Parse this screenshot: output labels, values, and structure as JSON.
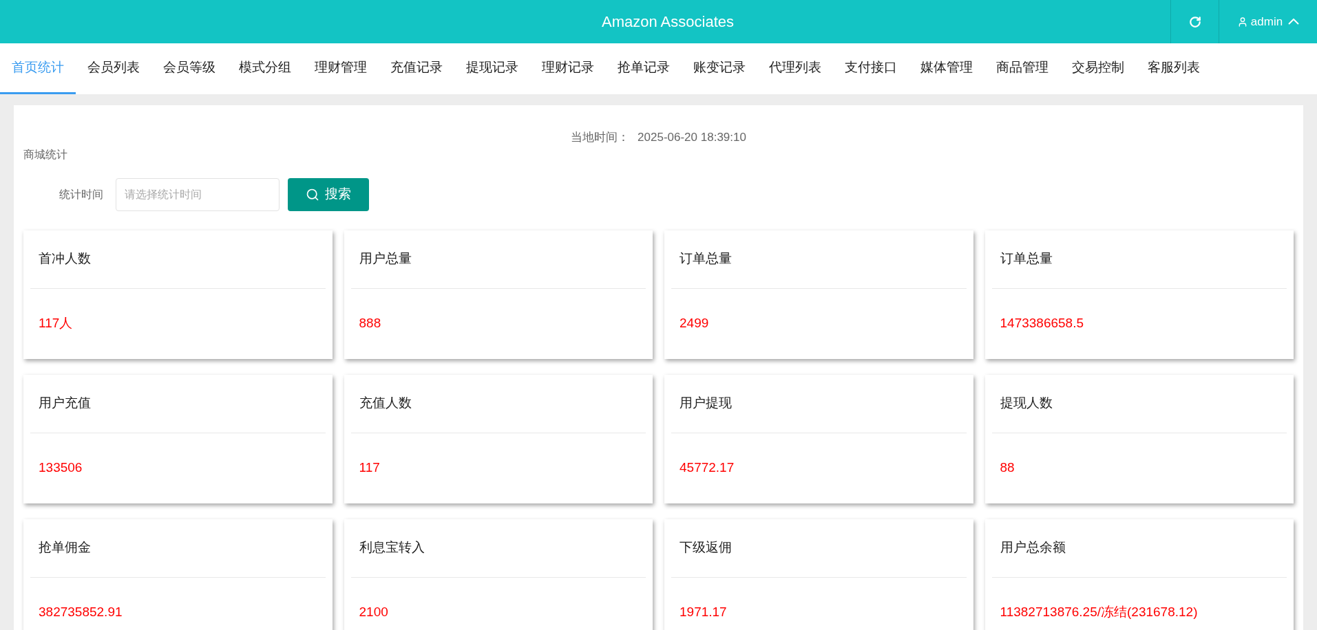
{
  "header": {
    "title": "Amazon Associates",
    "user": "admin"
  },
  "tabs": [
    {
      "label": "首页统计",
      "selected": true
    },
    {
      "label": "会员列表",
      "selected": false
    },
    {
      "label": "会员等级",
      "selected": false
    },
    {
      "label": "模式分组",
      "selected": false
    },
    {
      "label": "理财管理",
      "selected": false
    },
    {
      "label": "充值记录",
      "selected": false
    },
    {
      "label": "提现记录",
      "selected": false
    },
    {
      "label": "理财记录",
      "selected": false
    },
    {
      "label": "抢单记录",
      "selected": false
    },
    {
      "label": "账变记录",
      "selected": false
    },
    {
      "label": "代理列表",
      "selected": false
    },
    {
      "label": "支付接口",
      "selected": false
    },
    {
      "label": "媒体管理",
      "selected": false
    },
    {
      "label": "商品管理",
      "selected": false
    },
    {
      "label": "交易控制",
      "selected": false
    },
    {
      "label": "客服列表",
      "selected": false
    }
  ],
  "local_time": {
    "label": "当地时间：",
    "value": "2025-06-20 18:39:10"
  },
  "section_title": "商城统计",
  "filter": {
    "label": "统计时间",
    "placeholder": "请选择统计时间",
    "button": "搜索"
  },
  "cards": [
    {
      "title": "首冲人数",
      "value": "117人"
    },
    {
      "title": "用户总量",
      "value": "888"
    },
    {
      "title": "订单总量",
      "value": "2499"
    },
    {
      "title": "订单总量",
      "value": "1473386658.5"
    },
    {
      "title": "用户充值",
      "value": "133506"
    },
    {
      "title": "充值人数",
      "value": "117"
    },
    {
      "title": "用户提现",
      "value": "45772.17"
    },
    {
      "title": "提现人数",
      "value": "88"
    },
    {
      "title": "抢单佣金",
      "value": "382735852.91"
    },
    {
      "title": "利息宝转入",
      "value": "2100"
    },
    {
      "title": "下级返佣",
      "value": "1971.17"
    },
    {
      "title": "用户总余额",
      "value": "11382713876.25/冻结(231678.12)"
    }
  ]
}
